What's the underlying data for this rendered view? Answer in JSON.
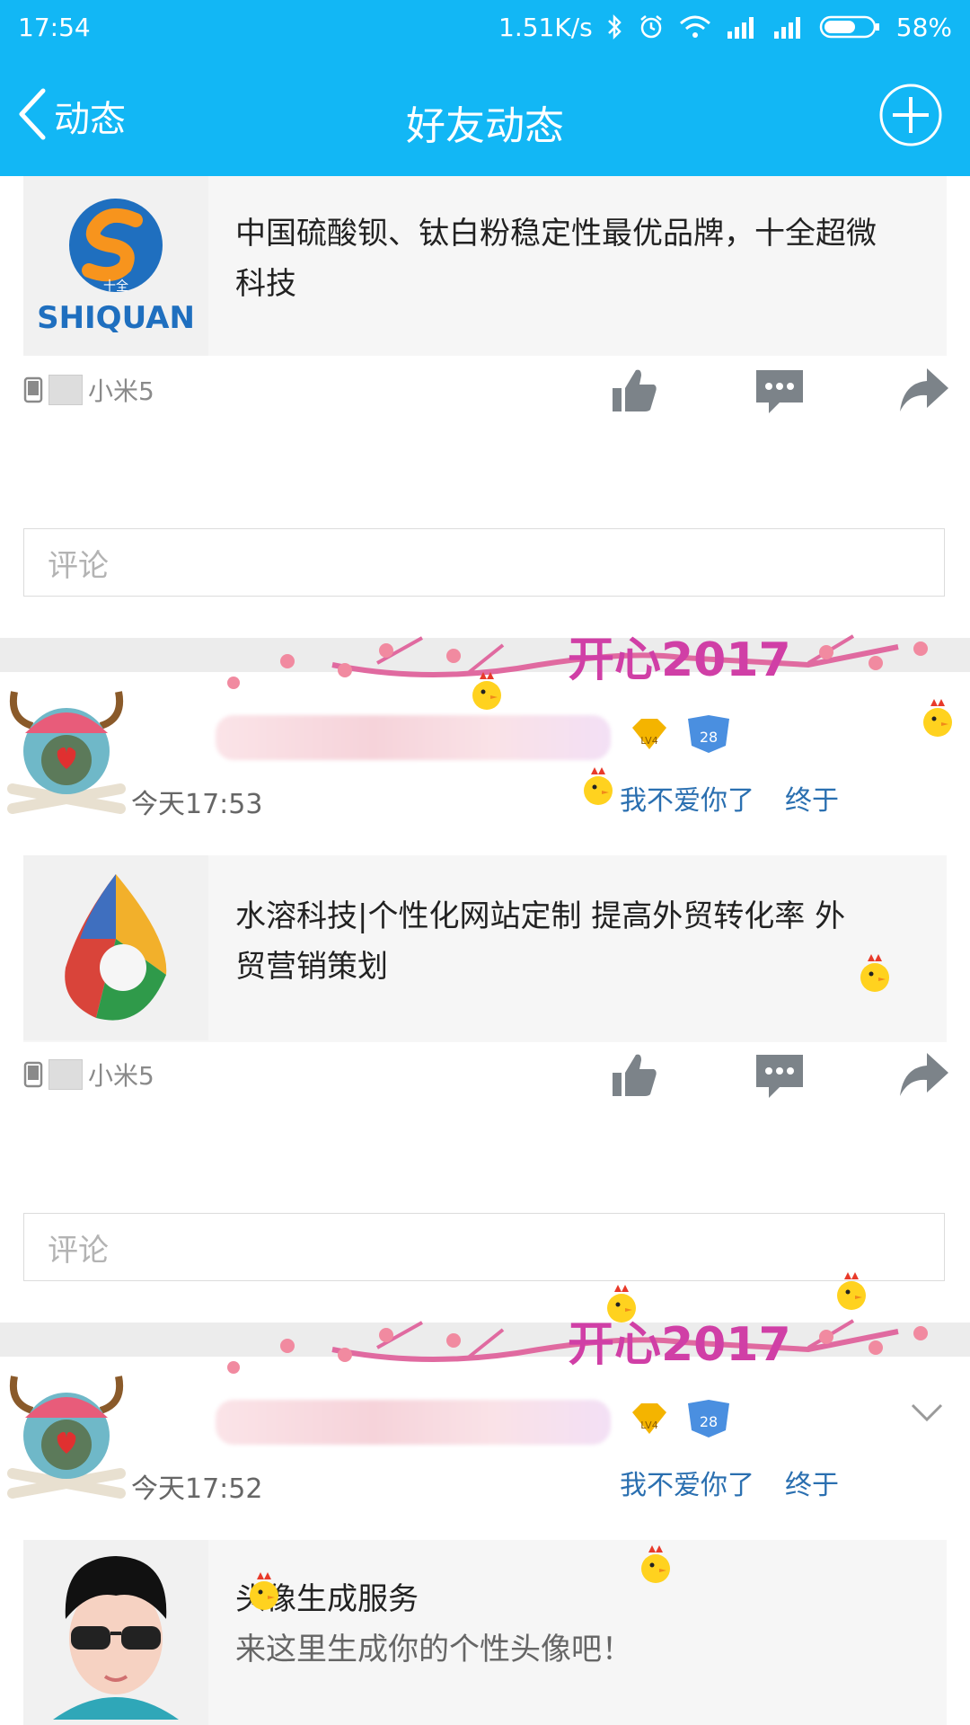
{
  "status_bar": {
    "time": "17:54",
    "net_speed": "1.51K/s",
    "battery": "58%",
    "icons": [
      "bluetooth-icon",
      "alarm-icon",
      "wifi-icon",
      "signal-icon",
      "signal-icon",
      "battery-icon"
    ]
  },
  "header": {
    "back_label": "动态",
    "title": "好友动态",
    "icons": [
      "back-chevron-icon",
      "plus-circle-icon"
    ]
  },
  "posts": [
    {
      "card_title": "中国硫酸钡、钛白粉稳定性最优品牌，十全超微",
      "card_title_2": "科技",
      "logo_cn": "十全",
      "logo_en": "SHIQUAN",
      "device": "小米5",
      "comment_placeholder": "评论"
    },
    {
      "time": "今天17:53",
      "tag1": "我不爱你了",
      "tag2": "终于",
      "banner_text": "开心2017",
      "badge_lv": "LV4",
      "badge_num": "28",
      "card_title": "水溶科技|个性化网站定制  提高外贸转化率  外",
      "card_title_2": "贸营销策划",
      "device": "小米5",
      "comment_placeholder": "评论"
    },
    {
      "time": "今天17:52",
      "tag1": "我不爱你了",
      "tag2": "终于",
      "banner_text": "开心2017",
      "badge_lv": "LV4",
      "badge_num": "28",
      "card_title": "头像生成服务",
      "card_sub": "来这里生成你的个性头像吧！"
    }
  ],
  "colors": {
    "accent": "#12B7F5",
    "tag_blue": "#2a6fb0",
    "icon_gray": "#7c8389"
  }
}
